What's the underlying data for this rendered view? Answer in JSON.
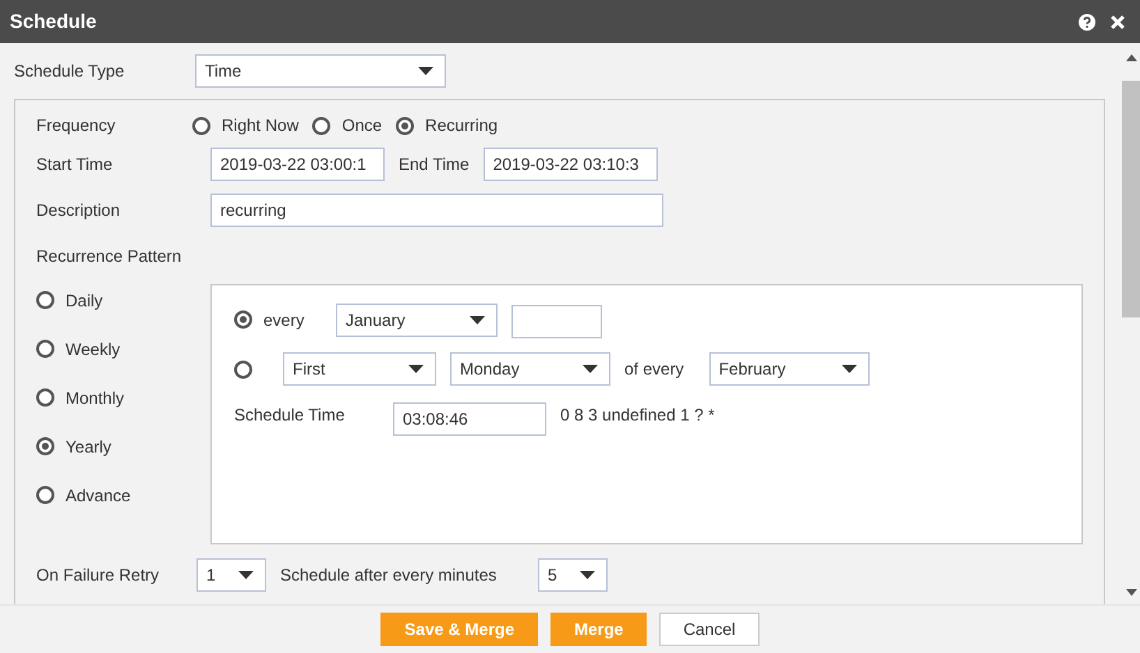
{
  "window": {
    "title": "Schedule"
  },
  "schedule_type": {
    "label": "Schedule Type",
    "value": "Time"
  },
  "frequency": {
    "label": "Frequency",
    "options": [
      {
        "label": "Right Now",
        "selected": false
      },
      {
        "label": "Once",
        "selected": false
      },
      {
        "label": "Recurring",
        "selected": true
      }
    ]
  },
  "start_time": {
    "label": "Start Time",
    "value": "2019-03-22 03:00:1"
  },
  "end_time": {
    "label": "End Time",
    "value": "2019-03-22 03:10:3"
  },
  "description": {
    "label": "Description",
    "value": "recurring"
  },
  "recurrence": {
    "label": "Recurrence Pattern",
    "options": [
      {
        "label": "Daily",
        "selected": false
      },
      {
        "label": "Weekly",
        "selected": false
      },
      {
        "label": "Monthly",
        "selected": false
      },
      {
        "label": "Yearly",
        "selected": true
      },
      {
        "label": "Advance",
        "selected": false
      }
    ],
    "every_row": {
      "selected": true,
      "label": "every",
      "month": "January"
    },
    "nth_row": {
      "selected": false,
      "ordinal": "First",
      "weekday": "Monday",
      "label": "of every",
      "month": "February"
    },
    "schedule_time": {
      "label": "Schedule Time",
      "value": "03:08:46"
    },
    "expression": "0 8 3 undefined 1 ? *"
  },
  "retry": {
    "label": "On Failure Retry",
    "value": "1"
  },
  "interval": {
    "label": "Schedule after every minutes",
    "value": "5"
  },
  "buttons": [
    {
      "label": "Save & Merge",
      "kind": "primary"
    },
    {
      "label": "Merge",
      "kind": "primary"
    },
    {
      "label": "Cancel",
      "kind": "secondary"
    }
  ]
}
